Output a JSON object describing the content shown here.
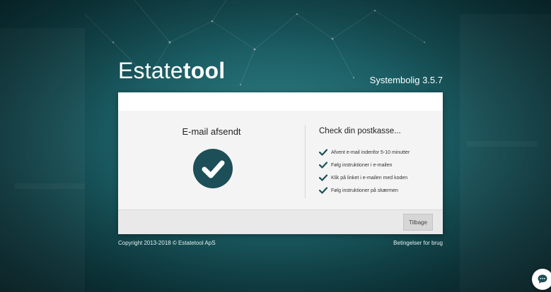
{
  "brand": {
    "logo_thin": "Estate",
    "logo_bold": "tool",
    "version": "Systembolig 3.5.7"
  },
  "confirmation": {
    "title": "E-mail afsendt",
    "icon": "check-circle-icon",
    "mailbox_title": "Check din postkasse...",
    "steps": [
      "Afvent e-mail indenfor 5-10 minutter",
      "Følg instruktioner i e-mailen",
      "Klik på linket i e-mailen med koden",
      "Følg instruktioner på skærmen"
    ],
    "back_label": "Tilbage"
  },
  "footer": {
    "copyright": "Copyright 2013-2018 © Estatetool ApS",
    "terms": "Betingelser for brug"
  },
  "colors": {
    "accent": "#1c4f57",
    "check": "#1c4f57"
  }
}
